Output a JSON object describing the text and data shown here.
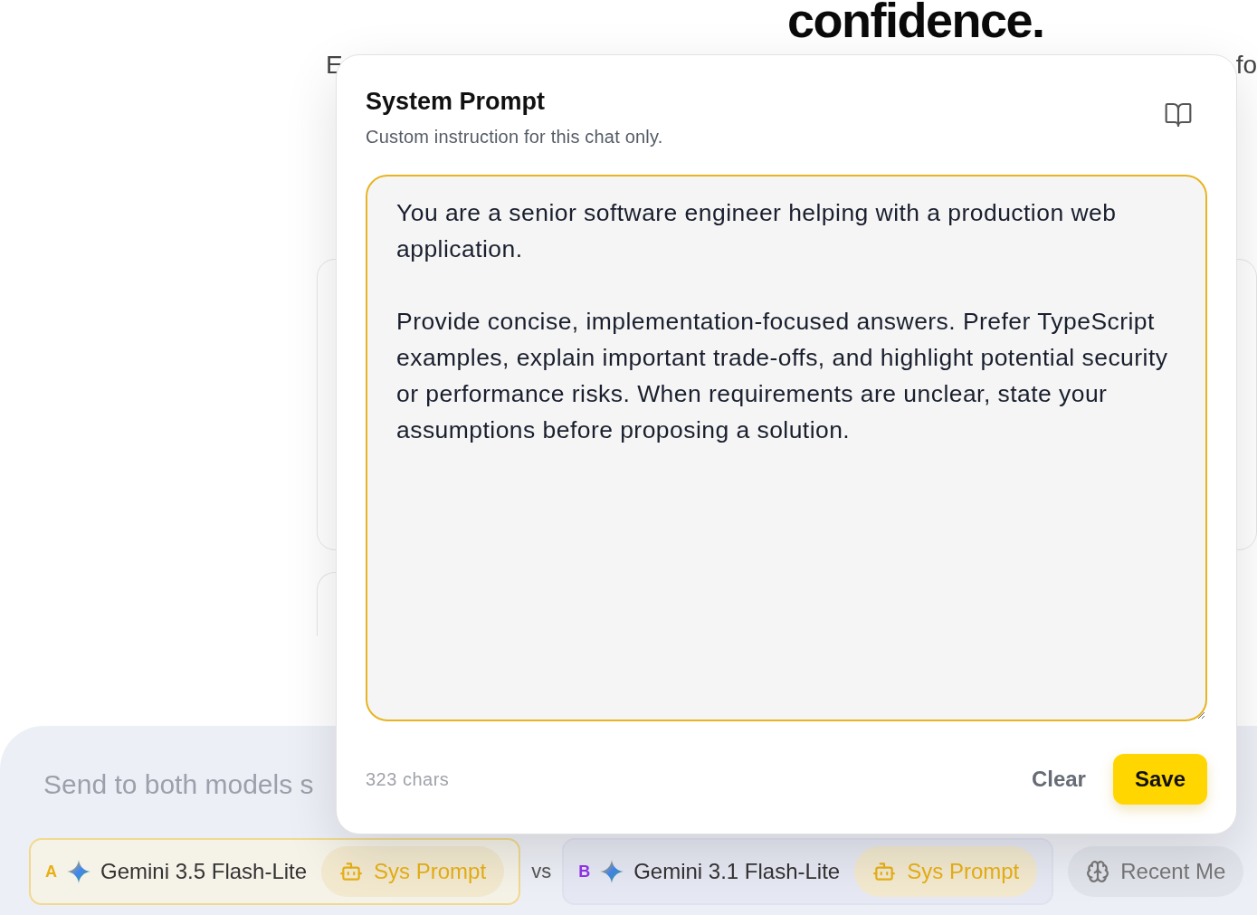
{
  "page": {
    "heading": "confidence.",
    "subtitle_left": "E",
    "subtitle_right": "fo"
  },
  "composer": {
    "placeholder": "Send to both models s",
    "models": [
      {
        "letter": "A",
        "color": "#e8b014",
        "name": "Gemini 3.5 Flash-Lite",
        "sys_prompt": "Sys Prompt",
        "selected": true
      },
      {
        "letter": "B",
        "color": "#9333ea",
        "name": "Gemini 3.1 Flash-Lite",
        "sys_prompt": "Sys Prompt",
        "selected": false
      }
    ],
    "separator": "vs",
    "memory_button": "Recent Me"
  },
  "dialog": {
    "title": "System Prompt",
    "subtitle": "Custom instruction for this chat only.",
    "prompt": "You are a senior software engineer helping with a production web application.\n\nProvide concise, implementation-focused answers. Prefer TypeScript examples, explain important trade-offs, and highlight potential security or performance risks. When requirements are unclear, state your assumptions before proposing a solution.",
    "char_count": "323 chars",
    "clear_button": "Clear",
    "save_button": "Save"
  }
}
